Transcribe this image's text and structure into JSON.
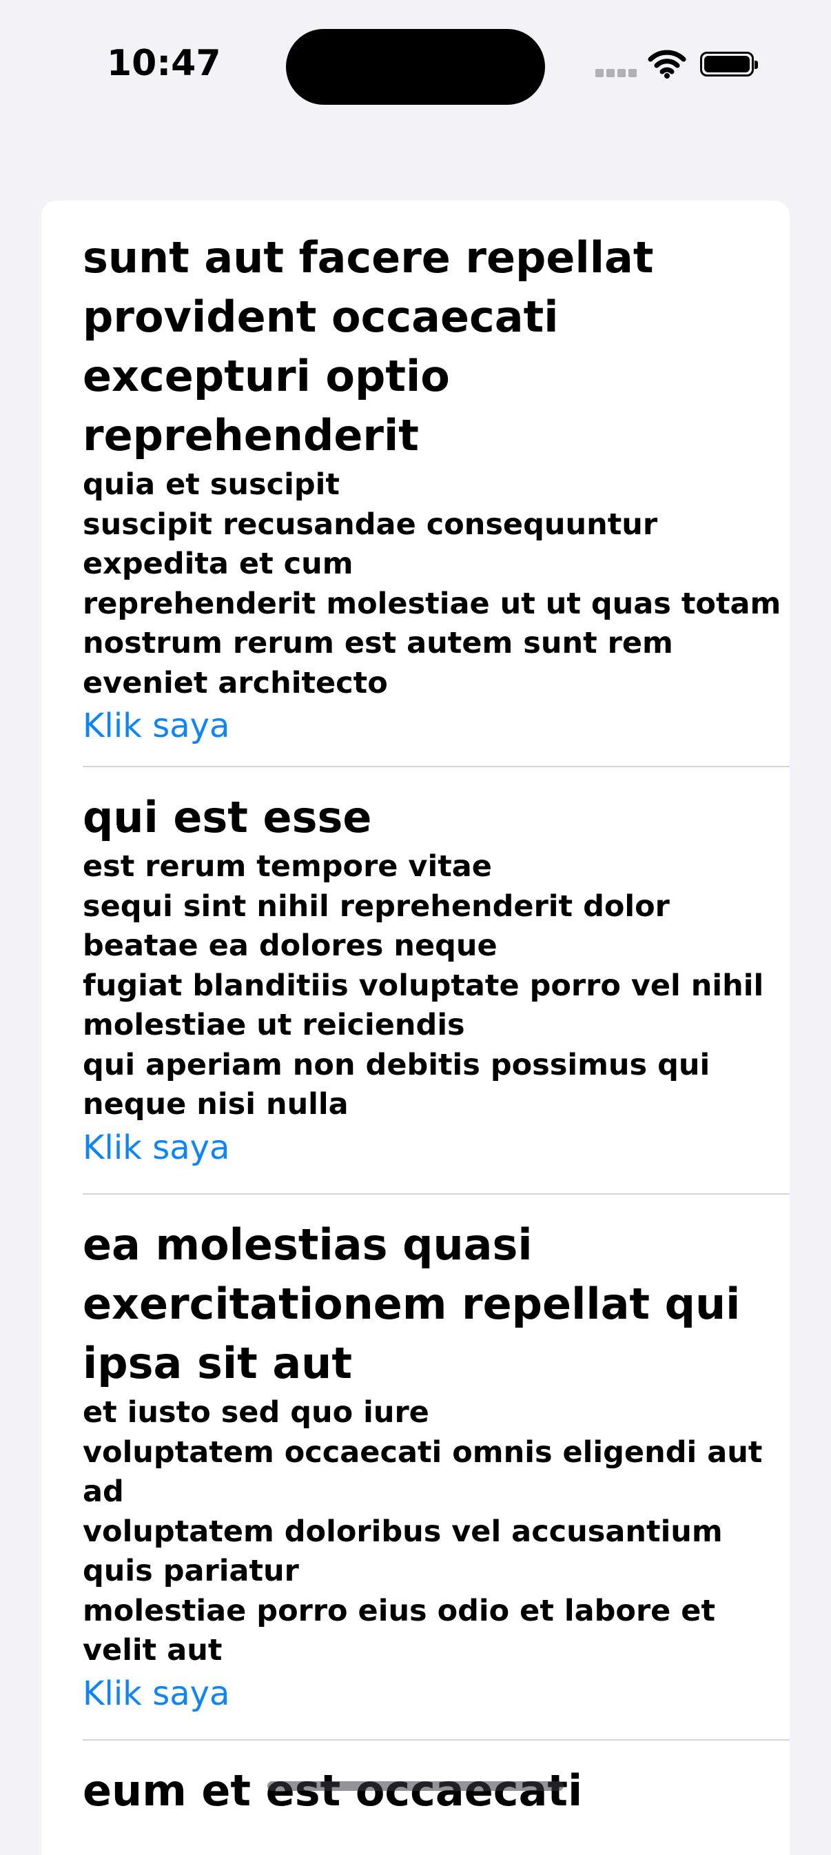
{
  "status_bar": {
    "time": "10:47",
    "icons": [
      "signal-dots-icon",
      "wifi-icon",
      "battery-icon"
    ]
  },
  "accent_color": "#0a84ff",
  "posts": [
    {
      "title": "sunt aut facere repellat provident occaecati excepturi optio reprehenderit",
      "body": "quia et suscipit\nsuscipit recusandae consequuntur expedita et cum\nreprehenderit molestiae ut ut quas totam\nnostrum rerum est autem sunt rem eveniet architecto",
      "link_label": "Klik saya"
    },
    {
      "title": "qui est esse",
      "body": "est rerum tempore vitae\nsequi sint nihil reprehenderit dolor beatae ea dolores neque\nfugiat blanditiis voluptate porro vel nihil molestiae ut reiciendis\nqui aperiam non debitis possimus qui neque nisi nulla",
      "link_label": "Klik saya"
    },
    {
      "title": "ea molestias quasi exercitationem repellat qui ipsa sit aut",
      "body": "et iusto sed quo iure\nvoluptatem occaecati omnis eligendi aut ad\nvoluptatem doloribus vel accusantium quis pariatur\nmolestiae porro eius odio et labore et velit aut",
      "link_label": "Klik saya"
    },
    {
      "title": "eum et est occaecati"
    }
  ]
}
